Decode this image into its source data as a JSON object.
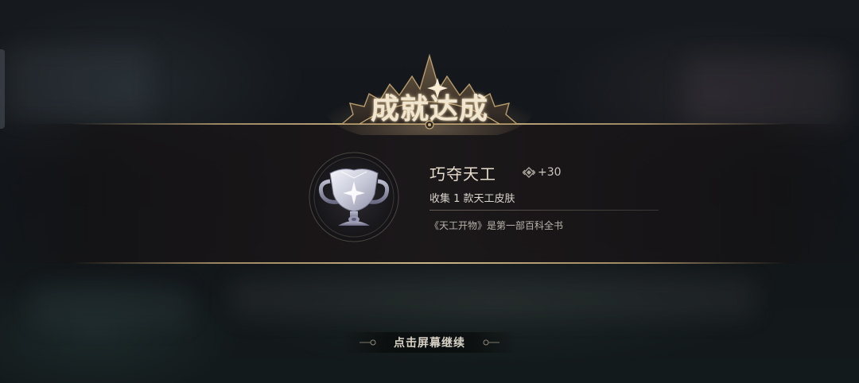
{
  "achievement_popup": {
    "header_title": "成就达成",
    "name": "巧夺天工",
    "reward": {
      "icon": "achievement-point-icon",
      "value": "+30"
    },
    "description": "收集 1 款天工皮肤",
    "flavor_text": "《天工开物》是第一部百科全书",
    "trophy_icon": "silver-trophy-icon"
  },
  "footer": {
    "continue_label": "点击屏幕继续"
  },
  "colors": {
    "gold_accent": "#d6be8c",
    "title_text": "#f1e6cf",
    "name_text": "#e6dccb",
    "trophy_silver": "#d9dbe6"
  }
}
